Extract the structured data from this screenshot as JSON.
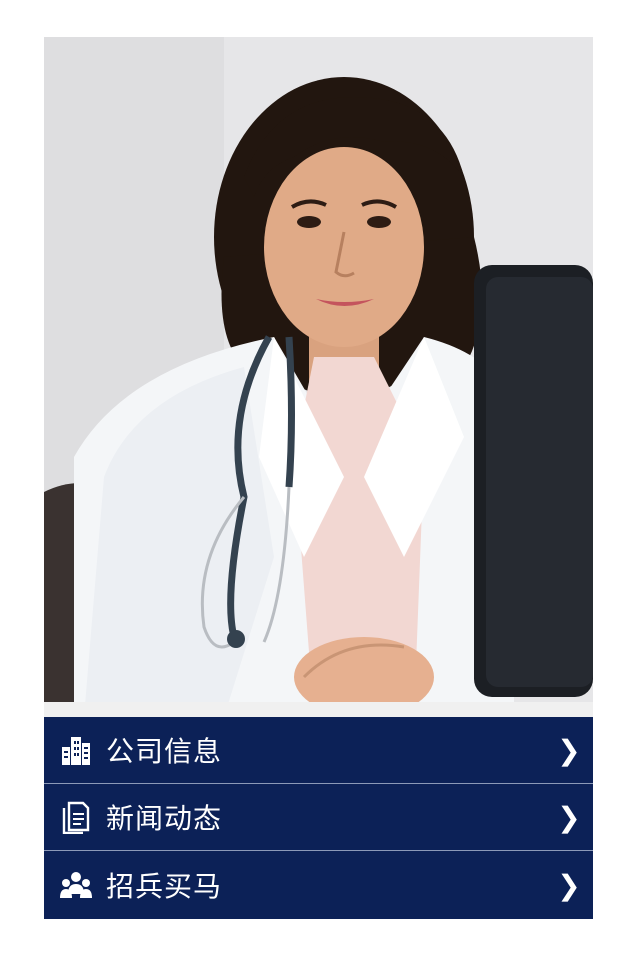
{
  "hero": {
    "image": "doctor-photo",
    "alt": "Smiling female doctor in white coat with stethoscope seated at a desk"
  },
  "menu": {
    "items": [
      {
        "label": "公司信息",
        "icon": "building-icon",
        "arrow": "❯"
      },
      {
        "label": "新闻动态",
        "icon": "document-icon",
        "arrow": "❯"
      },
      {
        "label": "招兵买马",
        "icon": "group-icon",
        "arrow": "❯"
      }
    ]
  },
  "colors": {
    "menu_bg": "#0c2157",
    "menu_text": "#ffffff",
    "divider": "#8d9ab8"
  }
}
